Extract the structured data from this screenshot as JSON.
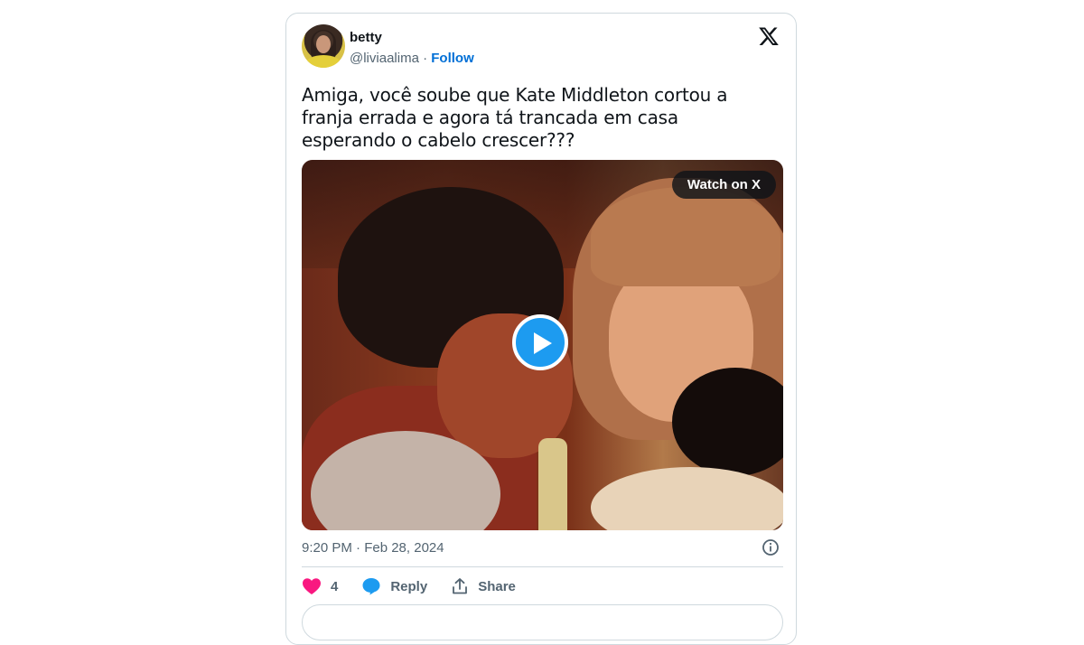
{
  "tweet": {
    "display_name": "betty",
    "handle": "@liviaalima",
    "separator": " · ",
    "follow_label": "Follow",
    "text": "Amiga, você soube que Kate Middleton cortou a franja errada e agora tá trancada em casa esperando o cabelo crescer???",
    "timestamp": "9:20 PM · Feb 28, 2024"
  },
  "media": {
    "watch_label": "Watch on X",
    "play_icon": "play-icon"
  },
  "actions": {
    "like_count": "4",
    "reply_label": "Reply",
    "share_label": "Share"
  },
  "colors": {
    "accent": "#1d9bf0",
    "follow": "#006fd6",
    "like": "#f91880",
    "muted": "#536471"
  }
}
